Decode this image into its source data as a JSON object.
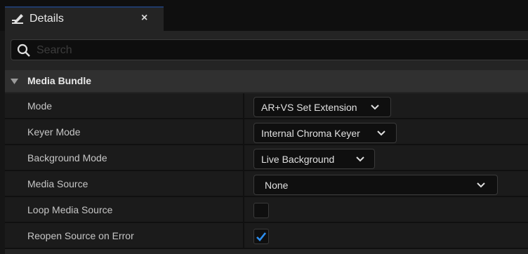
{
  "tab": {
    "title": "Details",
    "close_label": "×",
    "icon": "details-pencil-icon"
  },
  "search": {
    "placeholder": "Search",
    "value": ""
  },
  "category": {
    "label": "Media Bundle",
    "expanded": true
  },
  "properties": [
    {
      "label": "Mode",
      "type": "combo",
      "value": "AR+VS Set Extension"
    },
    {
      "label": "Keyer Mode",
      "type": "combo",
      "value": "Internal Chroma Keyer"
    },
    {
      "label": "Background Mode",
      "type": "combo",
      "value": "Live Background"
    },
    {
      "label": "Media Source",
      "type": "combo",
      "value": "None"
    },
    {
      "label": "Loop Media Source",
      "type": "checkbox",
      "checked": false
    },
    {
      "label": "Reopen Source on Error",
      "type": "checkbox",
      "checked": true
    }
  ],
  "colors": {
    "accent_check": "#2d8ff0",
    "panel_bg": "#242424",
    "row_bg": "#1b1b1b"
  }
}
